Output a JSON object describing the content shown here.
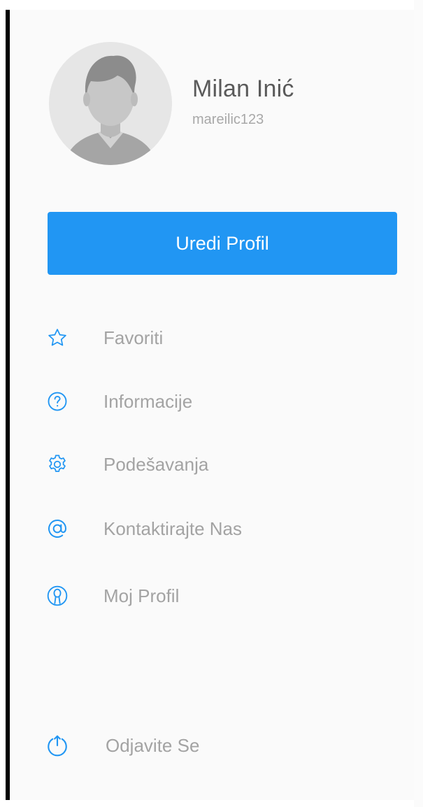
{
  "profile": {
    "name": "Milan Inić",
    "username": "mareilic123"
  },
  "edit_profile_button": "Uredi Profil",
  "menu": [
    {
      "label": "Favoriti",
      "icon": "star-icon"
    },
    {
      "label": "Informacije",
      "icon": "question-circle-icon"
    },
    {
      "label": "Podešavanja",
      "icon": "gear-icon"
    },
    {
      "label": "Kontaktirajte Nas",
      "icon": "at-sign-icon"
    },
    {
      "label": "Moj Profil",
      "icon": "user-circle-icon"
    }
  ],
  "logout": {
    "label": "Odjavite Se",
    "icon": "logout-icon"
  },
  "colors": {
    "accent": "#2196f3",
    "menu_text": "#a3a3a3",
    "name_text": "#5a5a5a",
    "drawer_background": "#fafafa"
  }
}
